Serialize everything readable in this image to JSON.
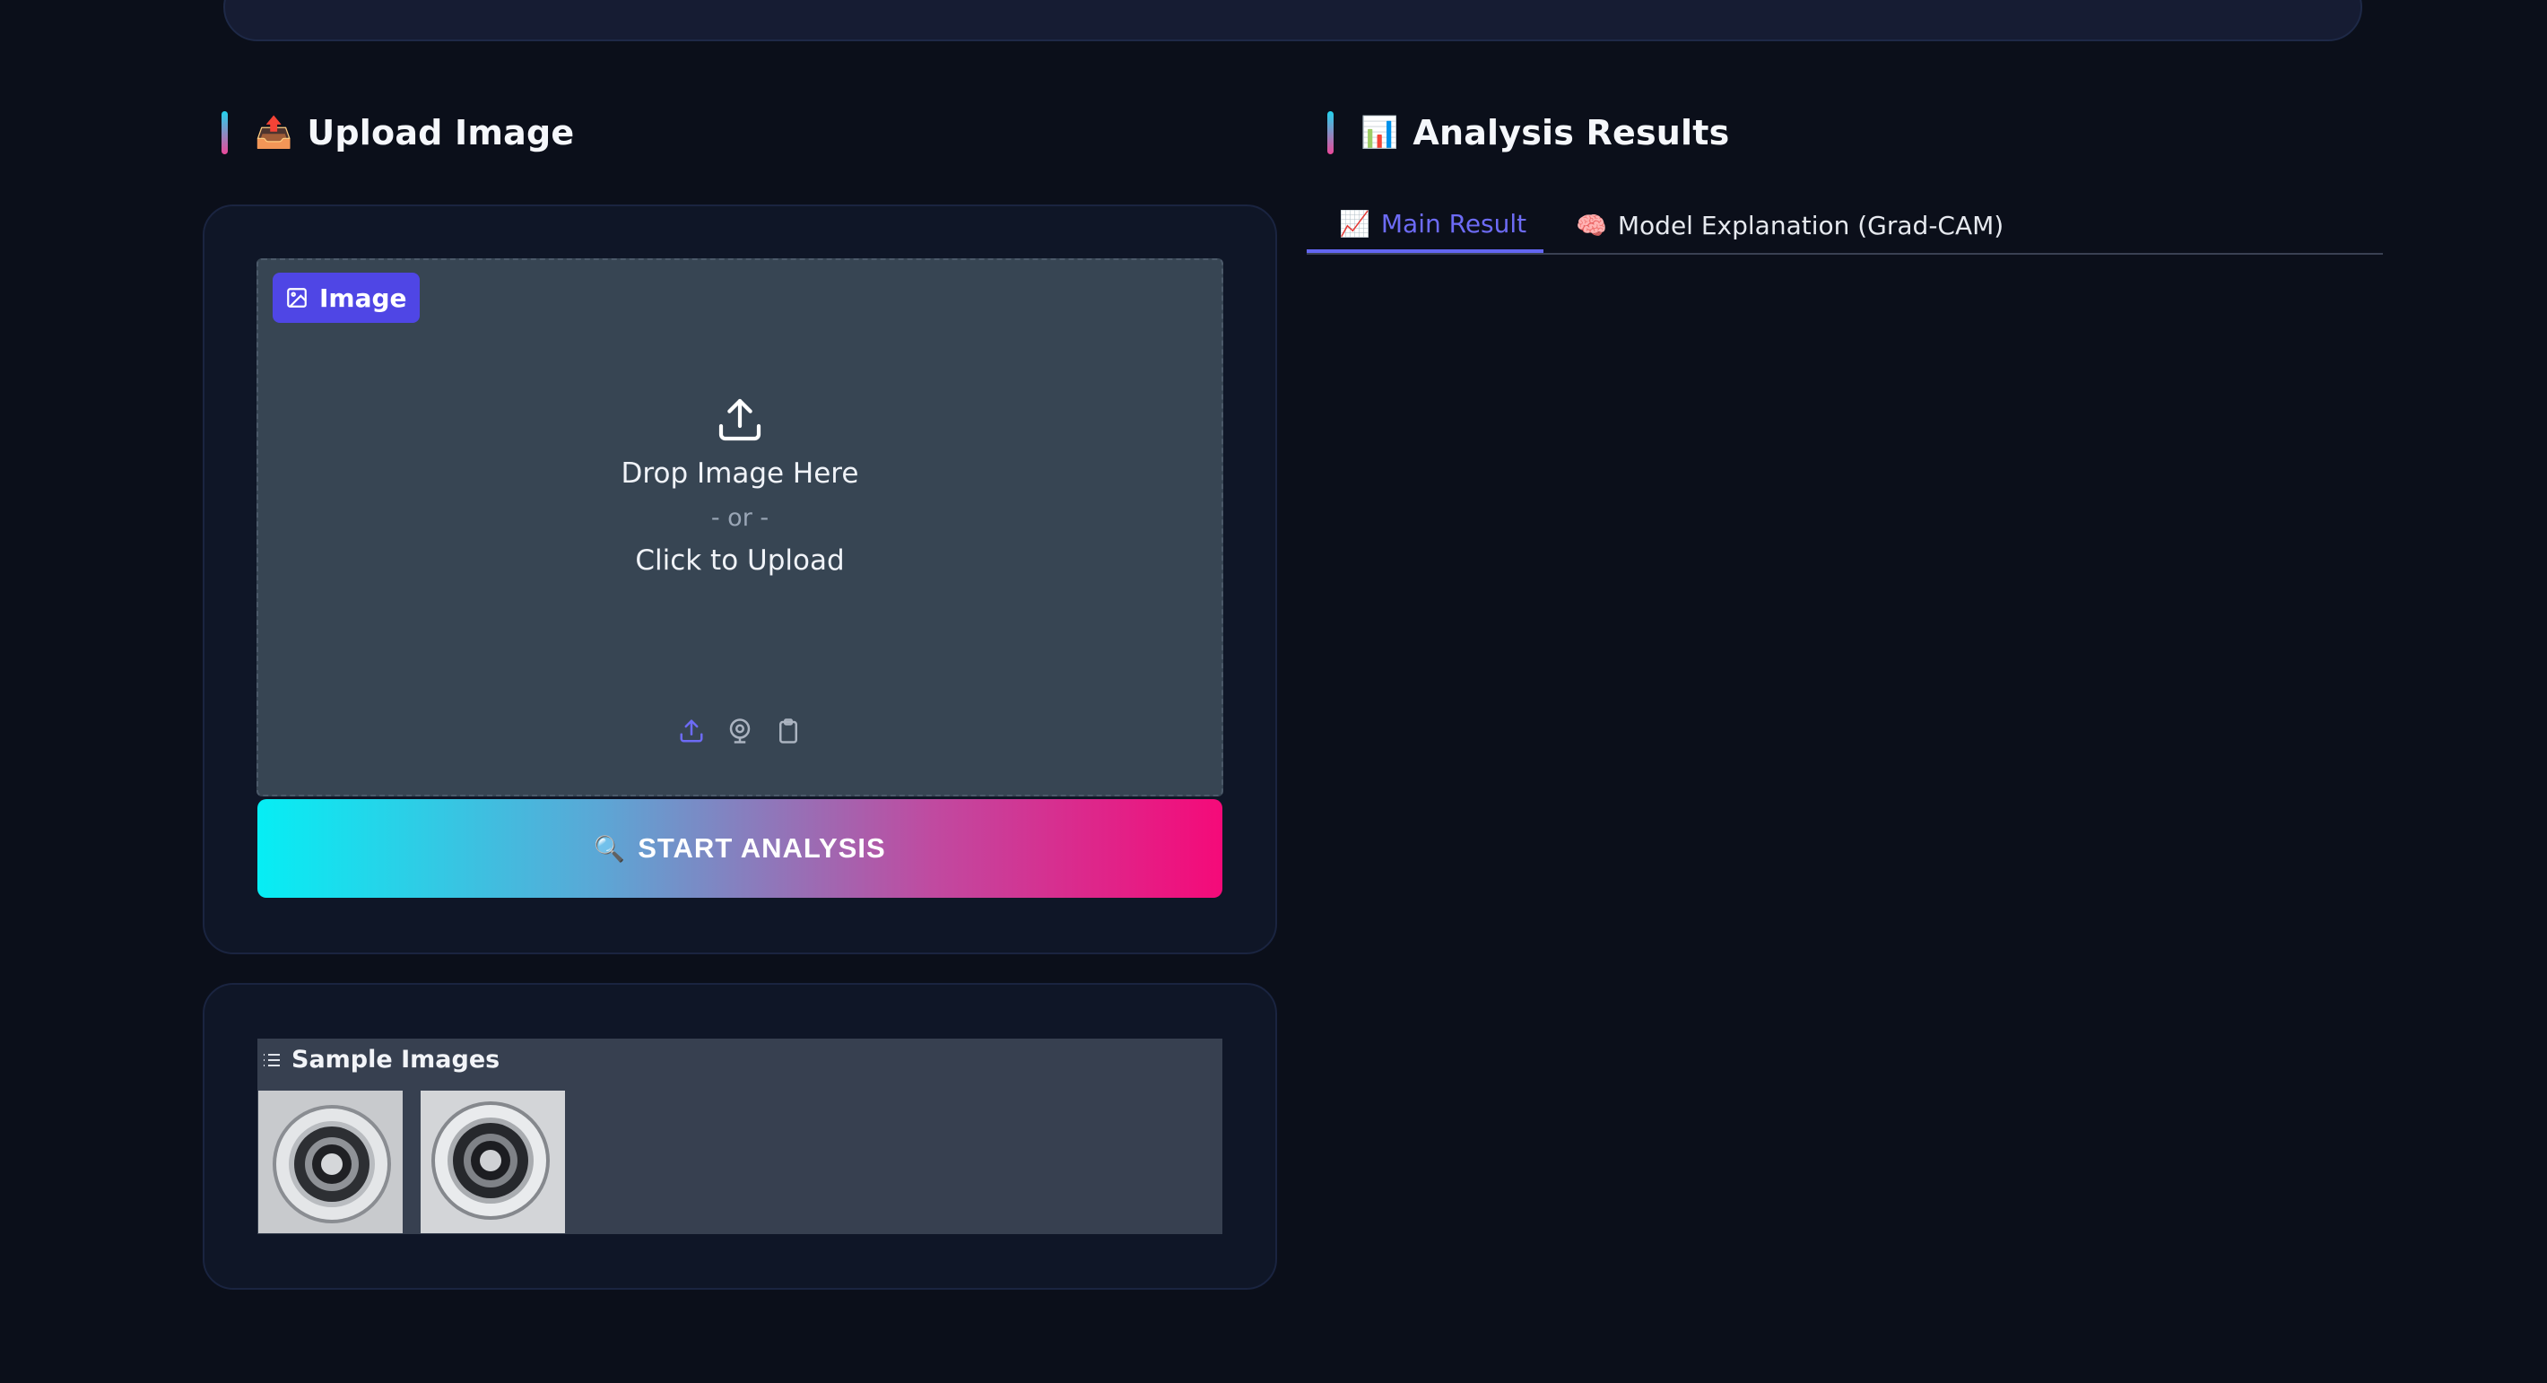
{
  "upload_section": {
    "emoji": "📤",
    "title": "Upload Image"
  },
  "image_input": {
    "badge_label": "Image",
    "drop_text": "Drop Image Here",
    "or_text": "- or -",
    "click_text": "Click to Upload"
  },
  "analyze_button": {
    "emoji": "🔍",
    "label": "START ANALYSIS"
  },
  "samples": {
    "title": "Sample Images",
    "items": [
      "sample-1",
      "sample-2"
    ]
  },
  "results_section": {
    "emoji": "📊",
    "title": "Analysis Results"
  },
  "tabs": [
    {
      "emoji": "📈",
      "label": "Main Result",
      "active": true
    },
    {
      "emoji": "🧠",
      "label": "Model Explanation (Grad-CAM)",
      "active": false
    }
  ],
  "colors": {
    "background": "#0b0f1a",
    "panel": "#0f1627",
    "accent": "#6366f1",
    "gradient_start": "#06eef4",
    "gradient_end": "#f50a79"
  }
}
